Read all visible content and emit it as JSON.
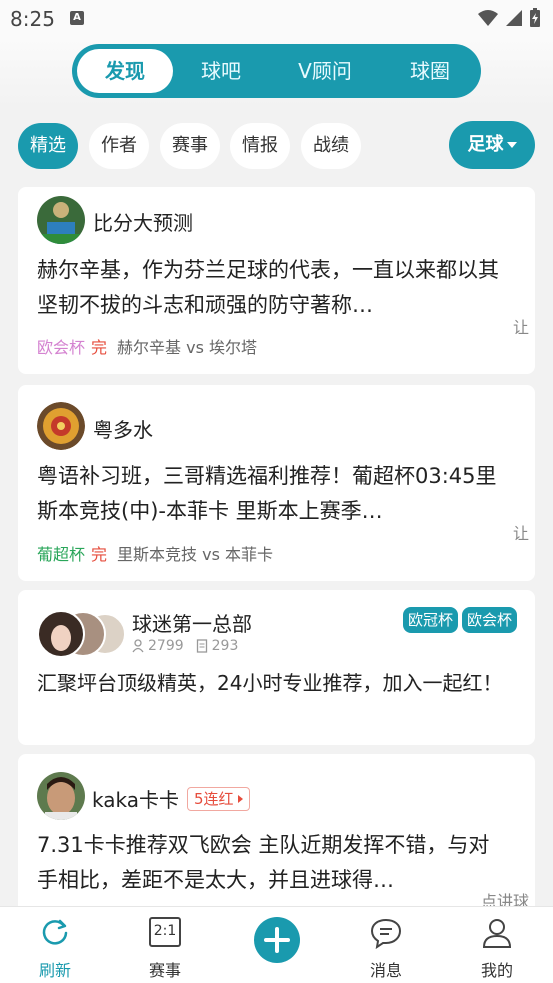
{
  "status": {
    "time": "8:25",
    "app_badge": "A"
  },
  "top_tabs": [
    "发现",
    "球吧",
    "V顾问",
    "球圈"
  ],
  "filters": [
    "精选",
    "作者",
    "赛事",
    "情报",
    "战绩"
  ],
  "sport_selector": "足球",
  "cards": [
    {
      "author": "比分大预测",
      "title": "赫尔辛基，作为芬兰足球的代表，一直以来都以其坚韧不拔的斗志和顽强的防守著称…",
      "league": "欧会杯",
      "state": "完",
      "teams": "赫尔辛基 vs 埃尔塔",
      "side": "让"
    },
    {
      "author": "粤多水",
      "title": "粤语补习班，三哥精选福利推荐！葡超杯03:45里斯本竞技(中)-本菲卡 里斯本上赛季…",
      "league": "葡超杯",
      "state": "完",
      "teams": "里斯本竞技 vs 本菲卡",
      "side": "让"
    },
    {
      "author": "球迷第一总部",
      "fans": "2799",
      "posts": "293",
      "tags": [
        "欧冠杯",
        "欧会杯"
      ],
      "title": "汇聚坪台顶级精英，24小时专业推荐，加入一起红！"
    },
    {
      "author": "kaka卡卡",
      "streak": "5连红",
      "title": "7.31卡卡推荐双飞欧会 主队近期发挥不错，与对手相比，差距不是太大，并且进球得…",
      "side": "点讲球"
    }
  ],
  "bottom_nav": [
    "刷新",
    "赛事",
    "消息",
    "我的"
  ],
  "bottom_nav_match_icon_text": "2:1",
  "colors": {
    "accent": "#1a9aae",
    "finished": "#e64c3c",
    "league_purple": "#d482d0",
    "league_green": "#2aa65a"
  }
}
